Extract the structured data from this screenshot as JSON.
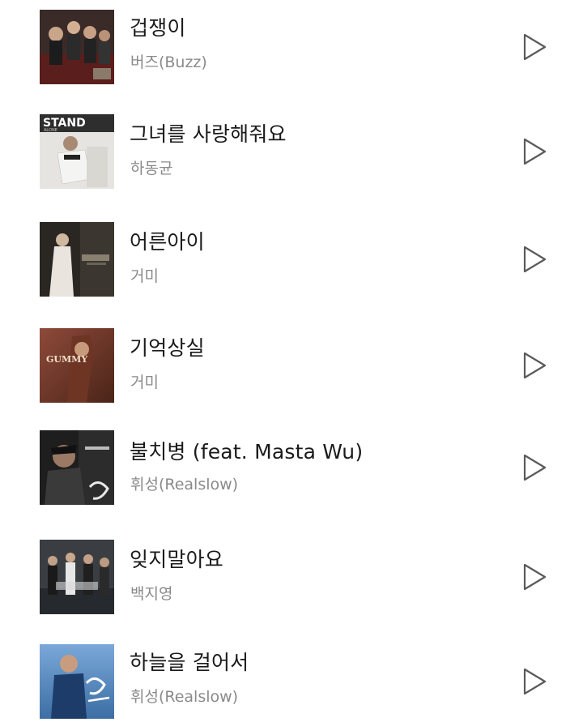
{
  "songs": [
    {
      "title": "겁쟁이",
      "artist": "버즈(Buzz)",
      "art": "buzz-album-cover"
    },
    {
      "title": "그녀를 사랑해줘요",
      "artist": "하동균",
      "art": "stand-alone-album-cover",
      "art_text": "STAND",
      "art_sub": "ALONE"
    },
    {
      "title": "어른아이",
      "artist": "거미",
      "art": "gummy-album-cover-1"
    },
    {
      "title": "기억상실",
      "artist": "거미",
      "art": "gummy-album-cover-2",
      "art_text": "GUMMY"
    },
    {
      "title": "불치병 (feat. Masta Wu)",
      "artist": "휘성(Realslow)",
      "art": "realslow-album-cover-1"
    },
    {
      "title": "잊지말아요",
      "artist": "백지영",
      "art": "baek-jiyoung-album-cover"
    },
    {
      "title": "하늘을 걸어서",
      "artist": "휘성(Realslow)",
      "art": "realslow-album-cover-2"
    }
  ],
  "icons": {
    "play": "play-icon"
  },
  "colors": {
    "title": "#1a1a1a",
    "artist": "#8a8a8a",
    "icon": "#5a5a5a"
  }
}
